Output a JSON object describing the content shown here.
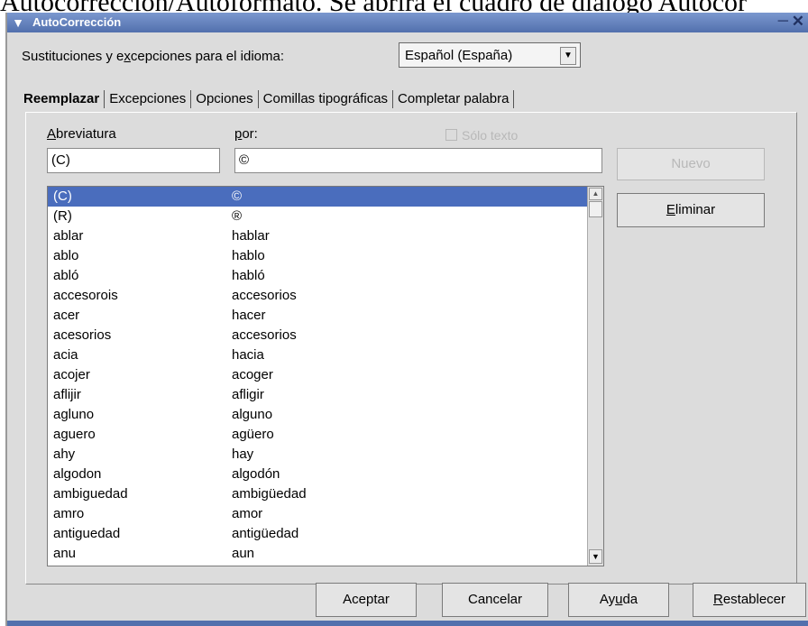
{
  "caption": "Autocorrección/Autoformato. Se abrirá el cuadro de diálogo Autocor",
  "window": {
    "title": "AutoCorrección"
  },
  "language": {
    "label_pre": "Sustituciones y e",
    "label_accel": "x",
    "label_post": "cepciones para el idioma:",
    "selected": "Español (España)"
  },
  "tabs": [
    "Reemplazar",
    "Excepciones",
    "Opciones",
    "Comillas tipográficas",
    "Completar palabra"
  ],
  "replace": {
    "abbr_label_accel": "A",
    "abbr_label_rest": "breviatura",
    "with_label_accel": "p",
    "with_label_rest": "or:",
    "abbr_value": "(C)",
    "with_value": "©",
    "text_only_label": "Sólo texto",
    "new_button": "Nuevo",
    "delete_button_accel": "E",
    "delete_button_rest": "liminar"
  },
  "entries": [
    [
      "(C)",
      "©"
    ],
    [
      "(R)",
      "®"
    ],
    [
      "ablar",
      "hablar"
    ],
    [
      "ablo",
      "hablo"
    ],
    [
      "abló",
      "habló"
    ],
    [
      "accesorois",
      "accesorios"
    ],
    [
      "acer",
      "hacer"
    ],
    [
      "acesorios",
      "accesorios"
    ],
    [
      "acia",
      "hacia"
    ],
    [
      "acojer",
      "acoger"
    ],
    [
      "aflijir",
      "afligir"
    ],
    [
      "agluno",
      "alguno"
    ],
    [
      "aguero",
      "agüero"
    ],
    [
      "ahy",
      "hay"
    ],
    [
      "algodon",
      "algodón"
    ],
    [
      "ambiguedad",
      "ambigüedad"
    ],
    [
      "amro",
      "amor"
    ],
    [
      "antiguedad",
      "antigüedad"
    ],
    [
      "anu",
      "aun"
    ]
  ],
  "footer": {
    "ok": "Aceptar",
    "cancel": "Cancelar",
    "help_pre": "Ay",
    "help_accel": "u",
    "help_post": "da",
    "reset_accel": "R",
    "reset_rest": "establecer"
  }
}
